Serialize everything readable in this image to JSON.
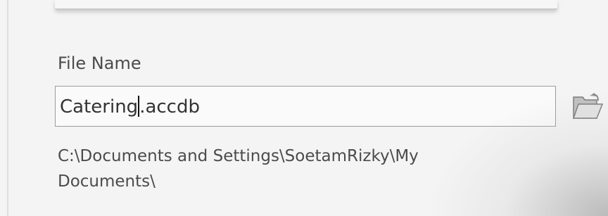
{
  "file_name_label": "File Name",
  "file_name_field": {
    "value_before_caret": "Catering",
    "value_after_caret": ".accdb"
  },
  "browse_icon": "open-folder-icon",
  "save_path_line1": "C:\\Documents and Settings\\SoetamRizky\\My",
  "save_path_line2": "Documents\\"
}
